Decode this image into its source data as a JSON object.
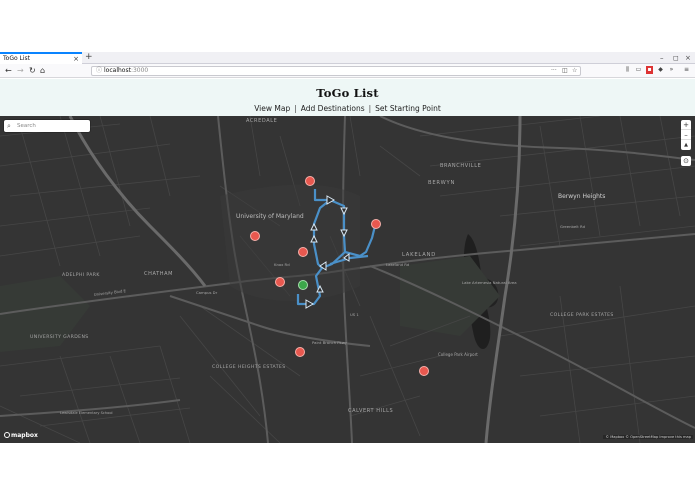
{
  "browser": {
    "tab_title": "ToGo List",
    "tab_close": "×",
    "new_tab": "+",
    "url_host": "localhost",
    "url_port": ":3000",
    "url_more": "···",
    "window_min": "–",
    "window_max": "◻",
    "window_close": "×"
  },
  "page": {
    "title": "ToGo List",
    "nav": [
      {
        "label": "View Map"
      },
      {
        "label": "Add Destinations"
      },
      {
        "label": "Set Starting Point"
      }
    ],
    "nav_separator": "|"
  },
  "map": {
    "search_placeholder": "Search",
    "zoom_in": "+",
    "zoom_out": "–",
    "compass": "▲",
    "geolocate": "⊙",
    "logo": "mapbox",
    "attribution": "© Mapbox © OpenStreetMap Improve this map",
    "route_color": "#4a90c8",
    "marker_color": "#e8584f",
    "start_color": "#3ca84a",
    "labels": {
      "acredale": "ACREDALE",
      "branchville": "BRANCHVILLE",
      "berwyn": "BERWYN",
      "berwyn_heights": "Berwyn Heights",
      "university_of_maryland": "University of Maryland",
      "lakeland": "LAKELAND",
      "chatham": "CHATHAM",
      "adelphi_park": "ADELPHI PARK",
      "university_gardens": "UNIVERSITY GARDENS",
      "college_heights_estates": "COLLEGE HEIGHTS ESTATES",
      "college_park_estates": "COLLEGE PARK ESTATES",
      "calvert_hills": "CALVERT HILLS",
      "college_park_airport": "College Park Airport",
      "lake_artemesia": "Lake Artemesia Natural Area",
      "university_blvd": "University Blvd E",
      "campus_dr": "Campus Dr",
      "knox_rd": "Knox Rd",
      "paint_branch": "Paint Branch Pkwy",
      "lakeland_rd": "Lakeland Rd",
      "greenbelt_rd": "Greenbelt Rd",
      "us_1": "US 1",
      "lewisdale": "Lewisdale Elementary School"
    }
  }
}
